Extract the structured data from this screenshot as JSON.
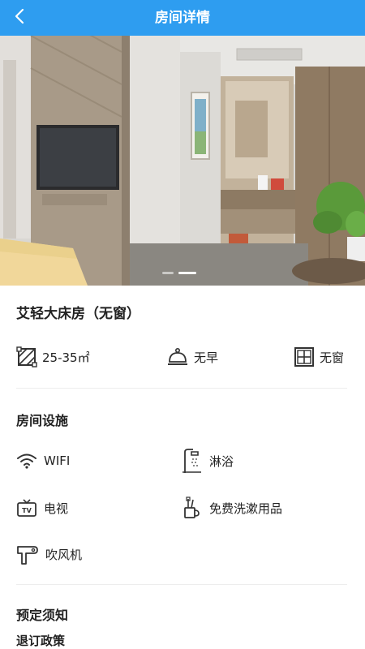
{
  "header": {
    "title": "房间详情"
  },
  "gallery": {
    "slide_count": 2,
    "active_slide": 2
  },
  "room": {
    "name": "艾轻大床房（无窗）",
    "specs": [
      {
        "icon": "area-icon",
        "label": "25-35㎡"
      },
      {
        "icon": "breakfast-bell-icon",
        "label": "无早"
      },
      {
        "icon": "window-icon",
        "label": "无窗"
      }
    ]
  },
  "facilities": {
    "title": "房间设施",
    "items": [
      {
        "icon": "wifi-icon",
        "label": "WIFI"
      },
      {
        "icon": "shower-icon",
        "label": "淋浴"
      },
      {
        "icon": "tv-icon",
        "label": "电视"
      },
      {
        "icon": "toiletries-icon",
        "label": "免费洗漱用品"
      },
      {
        "icon": "hair-dryer-icon",
        "label": "吹风机"
      }
    ]
  },
  "booking": {
    "title": "预定须知",
    "policy_title": "退订政策"
  }
}
